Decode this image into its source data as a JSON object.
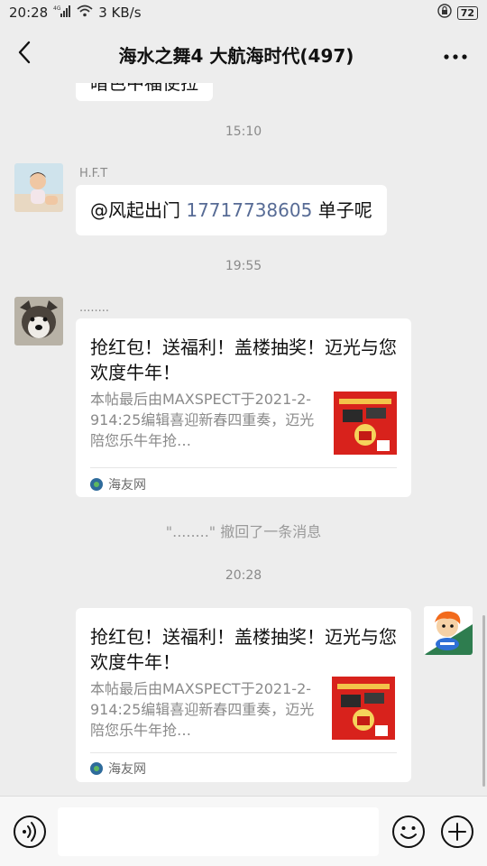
{
  "status_bar": {
    "time": "20:28",
    "signal": "4G",
    "speed": "3 KB/s",
    "battery": "72"
  },
  "header": {
    "title": "海水之舞4 大航海时代(497)"
  },
  "chat": {
    "partial_top_text": "暗色中福使拉",
    "time_1": "15:10",
    "msg1": {
      "sender": "H.F.T",
      "mention": "@风起出门 ",
      "phone": "17717738605",
      "suffix": " 单子呢"
    },
    "time_2": "19:55",
    "msg2": {
      "sender": "........",
      "title": "抢红包！送福利！盖楼抽奖！迈光与您欢度牛年！",
      "desc": "本帖最后由MAXSPECT于2021-2-914:25编辑喜迎新春四重奏，迈光陪您乐牛年抢…",
      "source": "海友网"
    },
    "recall": "\"........\" 撤回了一条消息",
    "time_3": "20:28",
    "msg3": {
      "title": "抢红包！送福利！盖楼抽奖！迈光与您欢度牛年！",
      "desc": "本帖最后由MAXSPECT于2021-2-914:25编辑喜迎新春四重奏，迈光陪您乐牛年抢…",
      "source": "海友网"
    }
  },
  "input_bar": {
    "placeholder": ""
  },
  "icons": {
    "back": "back-arrow-icon",
    "more": "more-dots-icon",
    "voice": "voice-icon",
    "emoji": "emoji-icon",
    "plus": "plus-icon",
    "source": "haiyou-logo-icon"
  },
  "colors": {
    "background": "#ededed",
    "bubble": "#ffffff",
    "link": "#576b95",
    "muted": "#8a8a8a"
  }
}
